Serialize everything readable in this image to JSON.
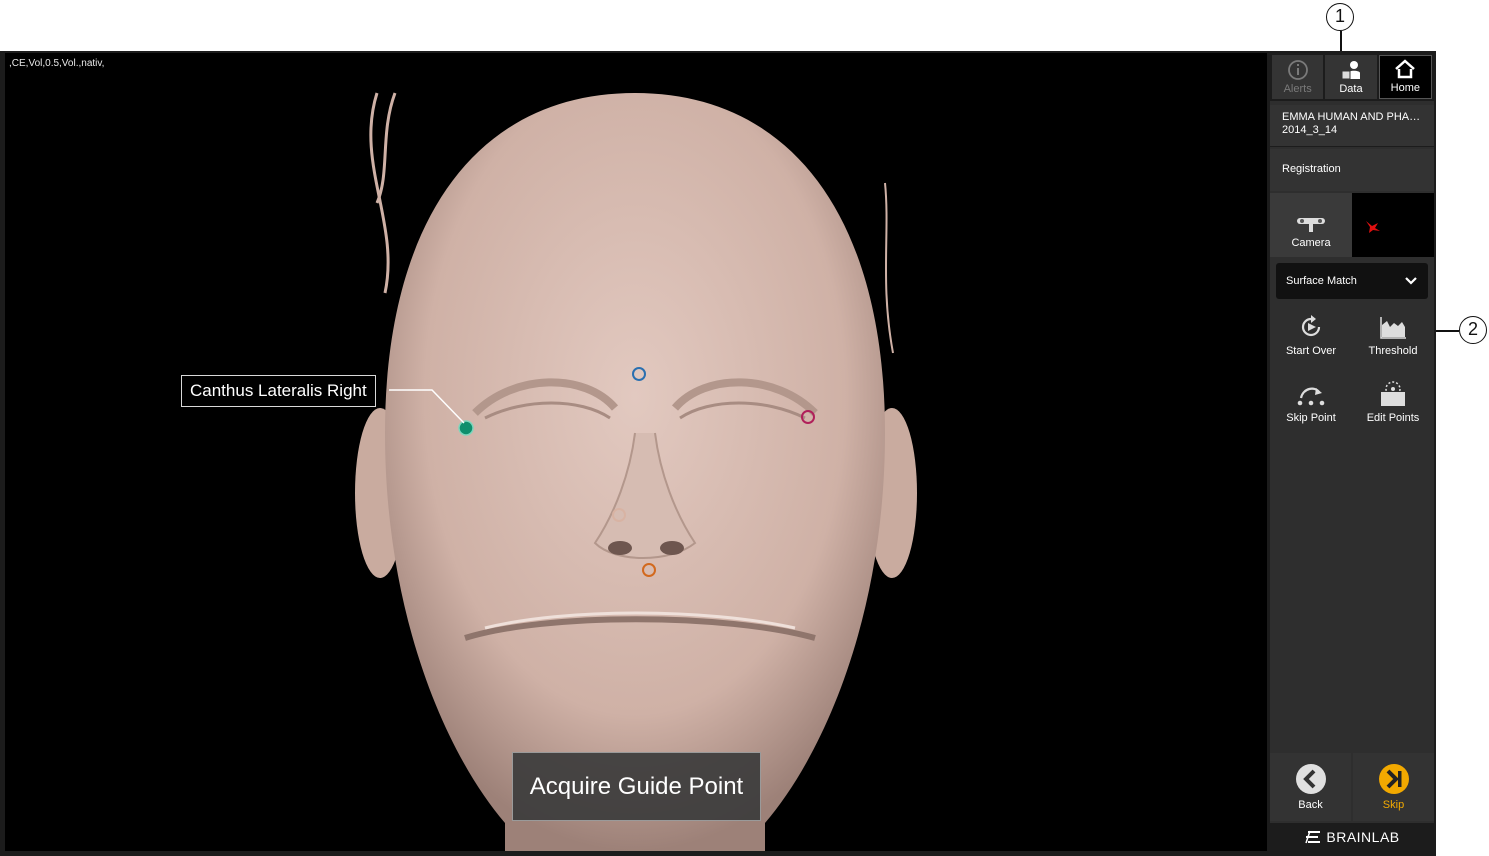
{
  "callouts": {
    "one": "1",
    "two": "2"
  },
  "viewer": {
    "info_text": ",CE,Vol,0.5,Vol.,nativ,",
    "point_label": "Canthus Lateralis Right",
    "acquire_label": "Acquire Guide Point"
  },
  "topbar": {
    "alerts_label": "Alerts",
    "data_label": "Data",
    "home_label": "Home"
  },
  "patient": {
    "name": "EMMA HUMAN AND PHAN...",
    "date": "2014_3_14"
  },
  "workflow": {
    "step": "Registration"
  },
  "camera": {
    "label": "Camera"
  },
  "dropdown": {
    "selected": "Surface Match"
  },
  "actions": {
    "start_over": "Start Over",
    "threshold": "Threshold",
    "skip_point": "Skip Point",
    "edit_points": "Edit Points"
  },
  "bottom": {
    "back": "Back",
    "skip": "Skip"
  },
  "brand": {
    "name": "BRAINLAB"
  },
  "colors": {
    "skip_accent": "#f2a900",
    "active_point": "#0e8f6d",
    "guide_blue": "#2a6fb0",
    "guide_magenta": "#b0205a",
    "guide_orange": "#d2691e"
  }
}
